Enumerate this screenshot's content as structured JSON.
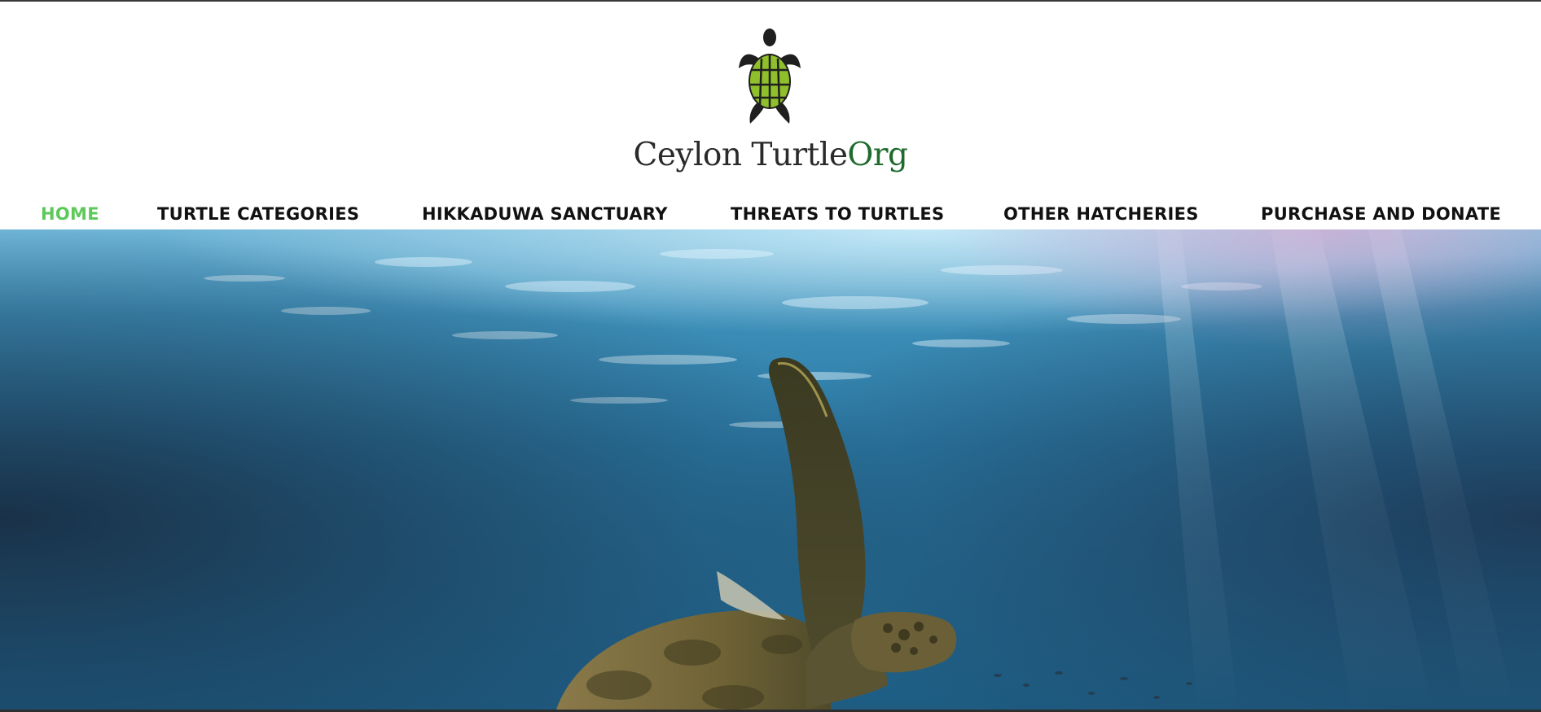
{
  "brand": {
    "name_part1": "Ceylon Turtle",
    "name_part2": "Org",
    "logo_icon": "sea-turtle-logo-icon"
  },
  "nav": {
    "items": [
      {
        "label": "HOME",
        "active": true
      },
      {
        "label": "TURTLE CATEGORIES",
        "active": false
      },
      {
        "label": "HIKKADUWA SANCTUARY",
        "active": false
      },
      {
        "label": "THREATS TO TURTLES",
        "active": false
      },
      {
        "label": "OTHER HATCHERIES",
        "active": false
      },
      {
        "label": "PURCHASE AND DONATE",
        "active": false
      }
    ]
  },
  "colors": {
    "active_nav": "#5cc95a",
    "nav_text": "#111111",
    "logo_shell": "#8fbf2a",
    "logo_body": "#1f1f1f",
    "brand_accent": "#1f6b2e"
  },
  "hero": {
    "image": "underwater-sea-turtle-photo"
  }
}
